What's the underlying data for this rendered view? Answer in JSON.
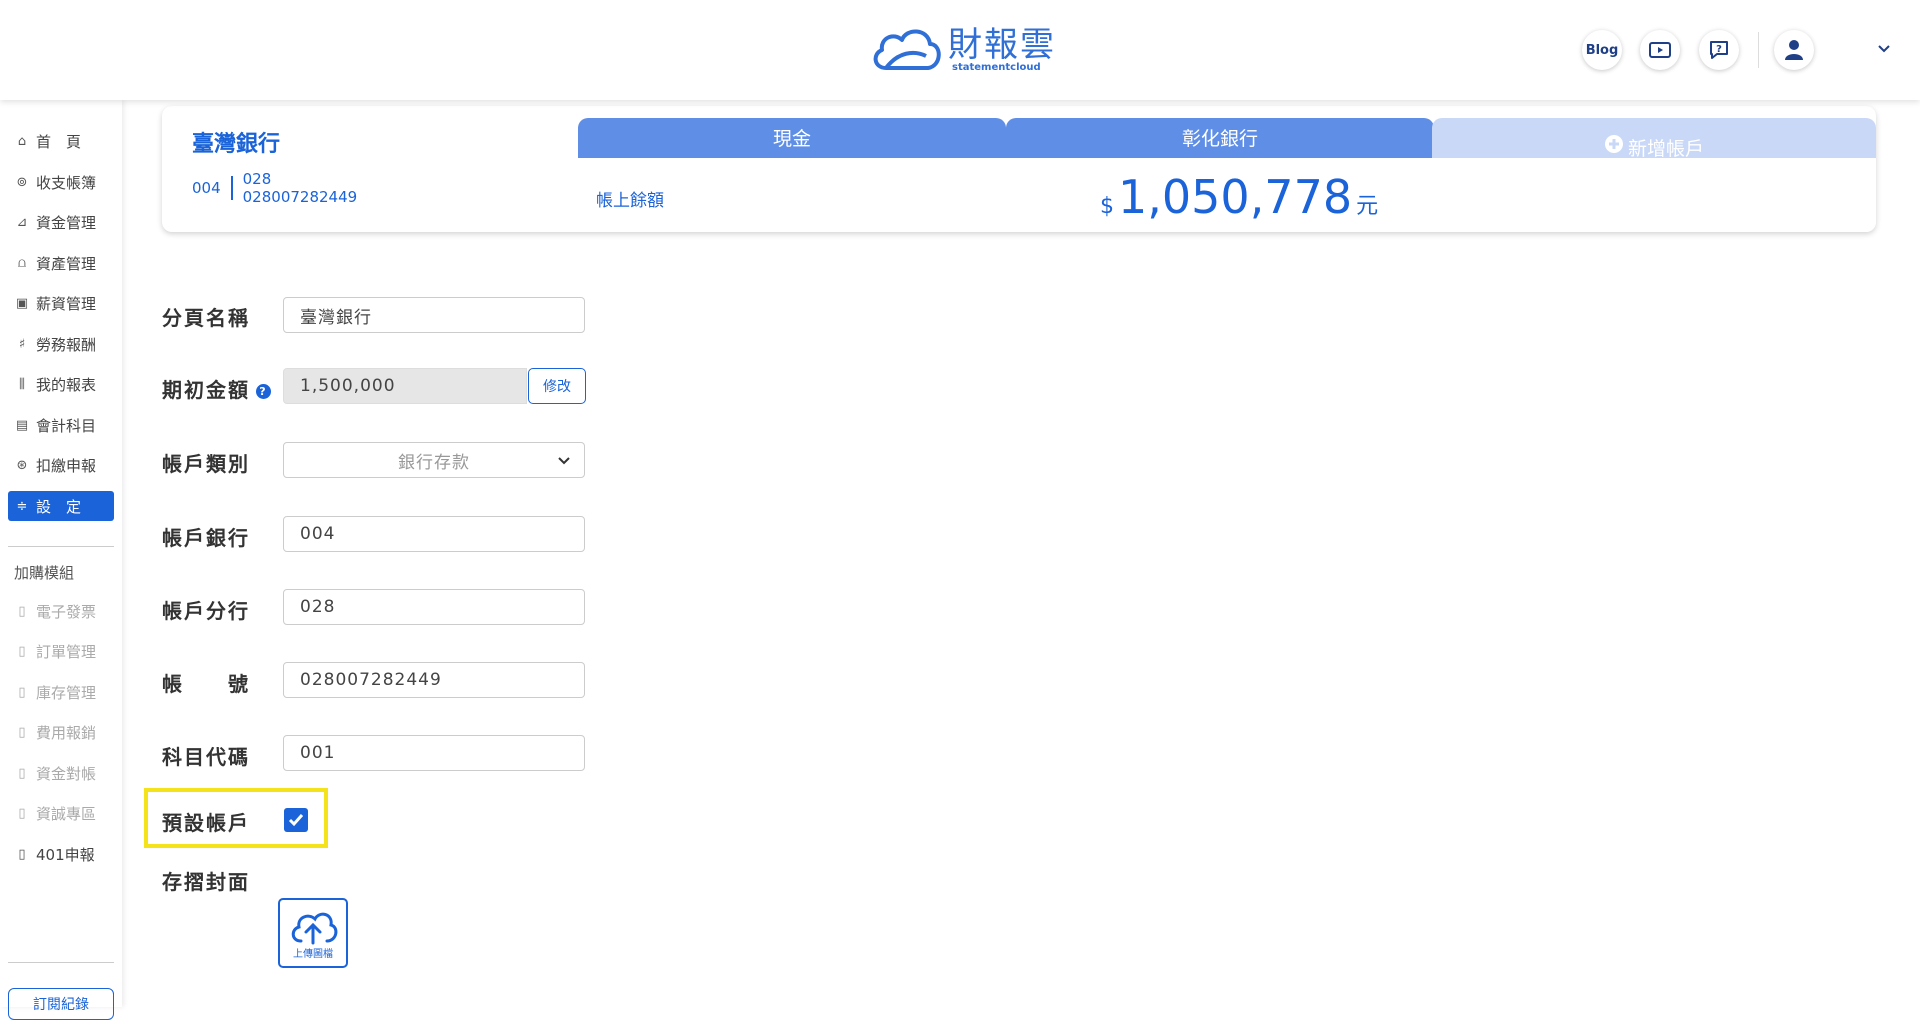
{
  "header": {
    "logo_title": "財報雲",
    "logo_sub": "statementcloud",
    "blog_label": "Blog",
    "icons": [
      "video-guide-icon",
      "help-chat-icon",
      "user-avatar-icon",
      "chevron-down-icon"
    ]
  },
  "sidebar": {
    "items": [
      {
        "label": "首　頁",
        "icon": "home-icon"
      },
      {
        "label": "收支帳簿",
        "icon": "coin-icon"
      },
      {
        "label": "資金管理",
        "icon": "fund-icon"
      },
      {
        "label": "資產管理",
        "icon": "asset-icon"
      },
      {
        "label": "薪資管理",
        "icon": "salary-icon"
      },
      {
        "label": "勞務報酬",
        "icon": "service-icon"
      },
      {
        "label": "我的報表",
        "icon": "report-icon"
      },
      {
        "label": "會計科目",
        "icon": "ledger-icon"
      },
      {
        "label": "扣繳申報",
        "icon": "tax-icon"
      },
      {
        "label": "設　定",
        "icon": "settings-icon"
      }
    ],
    "addon_heading": "加購模組",
    "addons": [
      {
        "label": "電子發票"
      },
      {
        "label": "訂單管理"
      },
      {
        "label": "庫存管理"
      },
      {
        "label": "費用報銷"
      },
      {
        "label": "資金對帳"
      },
      {
        "label": "資誠專區"
      },
      {
        "label": "401申報"
      }
    ],
    "order_label": "訂閱紀錄"
  },
  "account": {
    "name": "臺灣銀行",
    "bank_code": "004",
    "branch_code": "028",
    "account_no": "028007282449",
    "tabs": [
      "現金",
      "彰化銀行",
      "新增帳戶"
    ],
    "balance_label": "帳上餘額",
    "currency_symbol": "$",
    "balance": "1,050,778",
    "balance_unit": "元"
  },
  "form": {
    "page_name_label": "分頁名稱",
    "page_name_value": "臺灣銀行",
    "initial_amount_label": "期初金額",
    "initial_amount_value": "1,500,000",
    "edit_label": "修改",
    "account_type_label": "帳戶類別",
    "account_type_value": "銀行存款",
    "bank_label": "帳戶銀行",
    "bank_value": "004",
    "branch_label": "帳戶分行",
    "branch_value": "028",
    "account_no_label": "帳　　號",
    "account_no_value": "028007282449",
    "subject_code_label": "科目代碼",
    "subject_code_value": "001",
    "default_account_label": "預設帳戶",
    "default_account_checked": true,
    "cover_label": "存摺封面",
    "upload_label": "上傳圖檔"
  },
  "colors": {
    "accent": "#1a63d8",
    "tab": "#5f8ee6",
    "tab_add": "#c9d8f7",
    "highlight": "#f4e21a"
  }
}
